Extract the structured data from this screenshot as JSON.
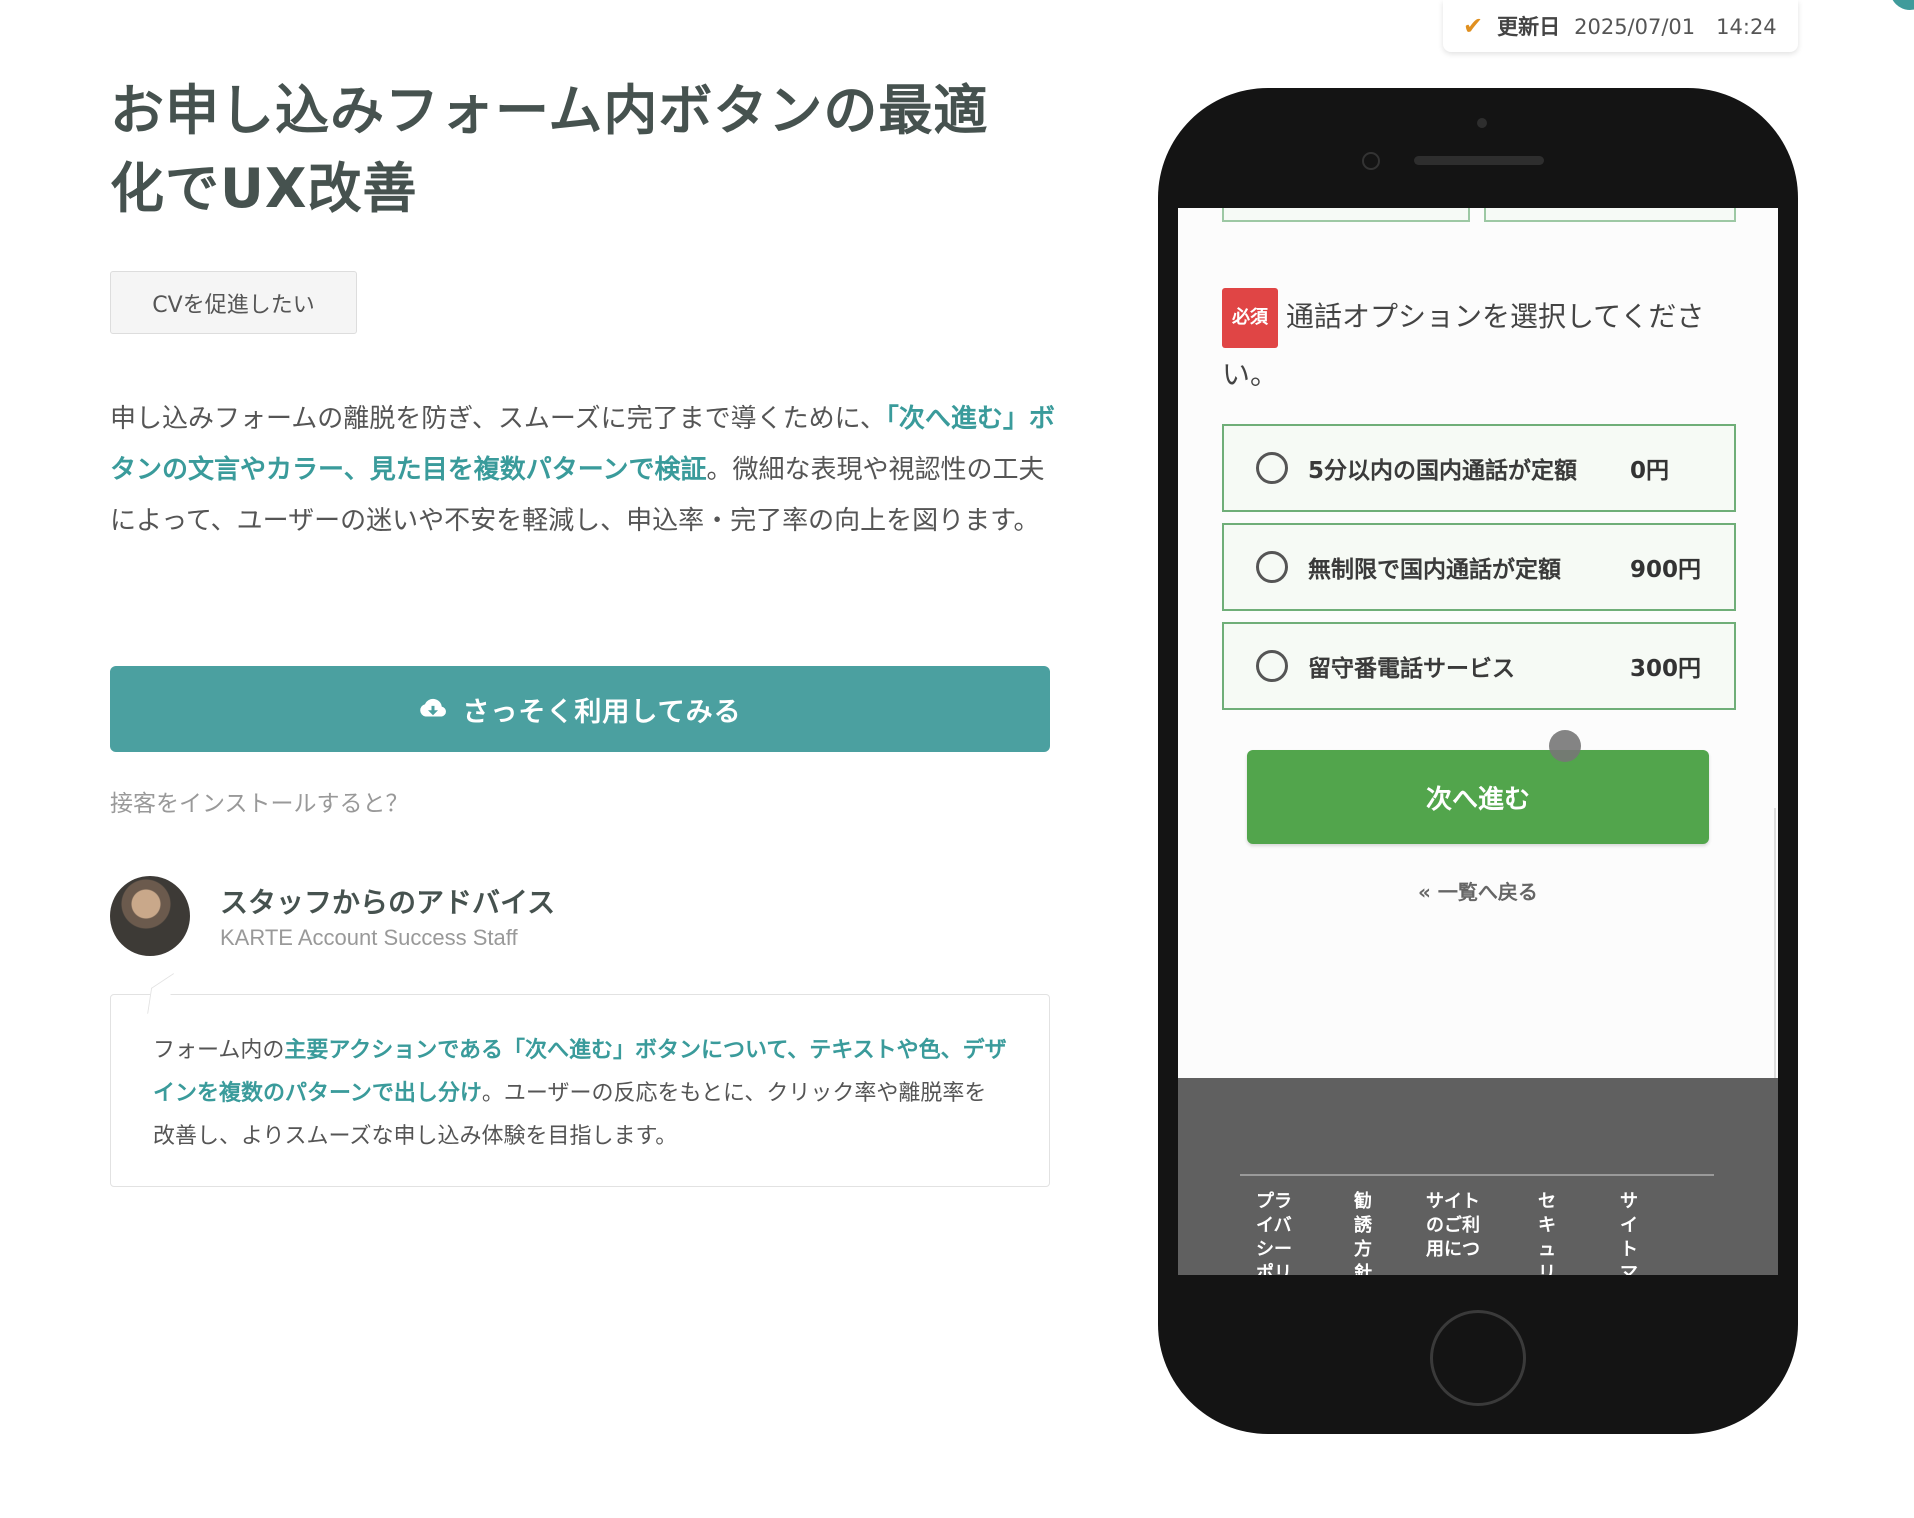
{
  "updated": {
    "label": "更新日",
    "value": "2025/07/01　14:24"
  },
  "title": "お申し込みフォーム内ボタンの最適化でUX改善",
  "tag": "CVを促進したい",
  "lead": {
    "part1": "申し込みフォームの離脱を防ぎ、スムーズに完了まで導くために、",
    "highlight": "「次へ進む」ボタンの文言やカラー、見た目を複数パターンで検証",
    "part2": "。微細な表現や視認性の工夫によって、ユーザーの迷いや不安を軽減し、申込率・完了率の向上を図ります。"
  },
  "cta": {
    "label": "さっそく利用してみる",
    "icon": "cloud-download-icon"
  },
  "install_link": "接客をインストールすると？",
  "staff": {
    "name": "スタッフからのアドバイス",
    "role": "KARTE Account Success Staff"
  },
  "advice": {
    "part1": "フォーム内の",
    "highlight": "主要アクションである「次へ進む」ボタンについて、テキストや色、デザインを複数のパターンで出し分け",
    "part2": "。ユーザーの反応をもとに、クリック率や離脱率を改善し、よりスムーズな申し込み体験を目指します。"
  },
  "phone": {
    "required_badge": "必須",
    "question": "通話オプションを選択してください。",
    "options": [
      {
        "label": "5分以内の国内通話が定額",
        "price": "0円"
      },
      {
        "label": "無制限で国内通話が定額",
        "price": "900円"
      },
      {
        "label": "留守番電話サービス",
        "price": "300円"
      }
    ],
    "next_button": "次へ進む",
    "back_link": "« 一覧へ戻る",
    "footer_items": [
      "プライバシーポリ",
      "勧誘方針",
      "サイトのご利用につ",
      "セキュリ",
      "サイトマ"
    ]
  },
  "colors": {
    "accent": "#4ba0a0",
    "next_button": "#52a54c",
    "required": "#e04545"
  }
}
